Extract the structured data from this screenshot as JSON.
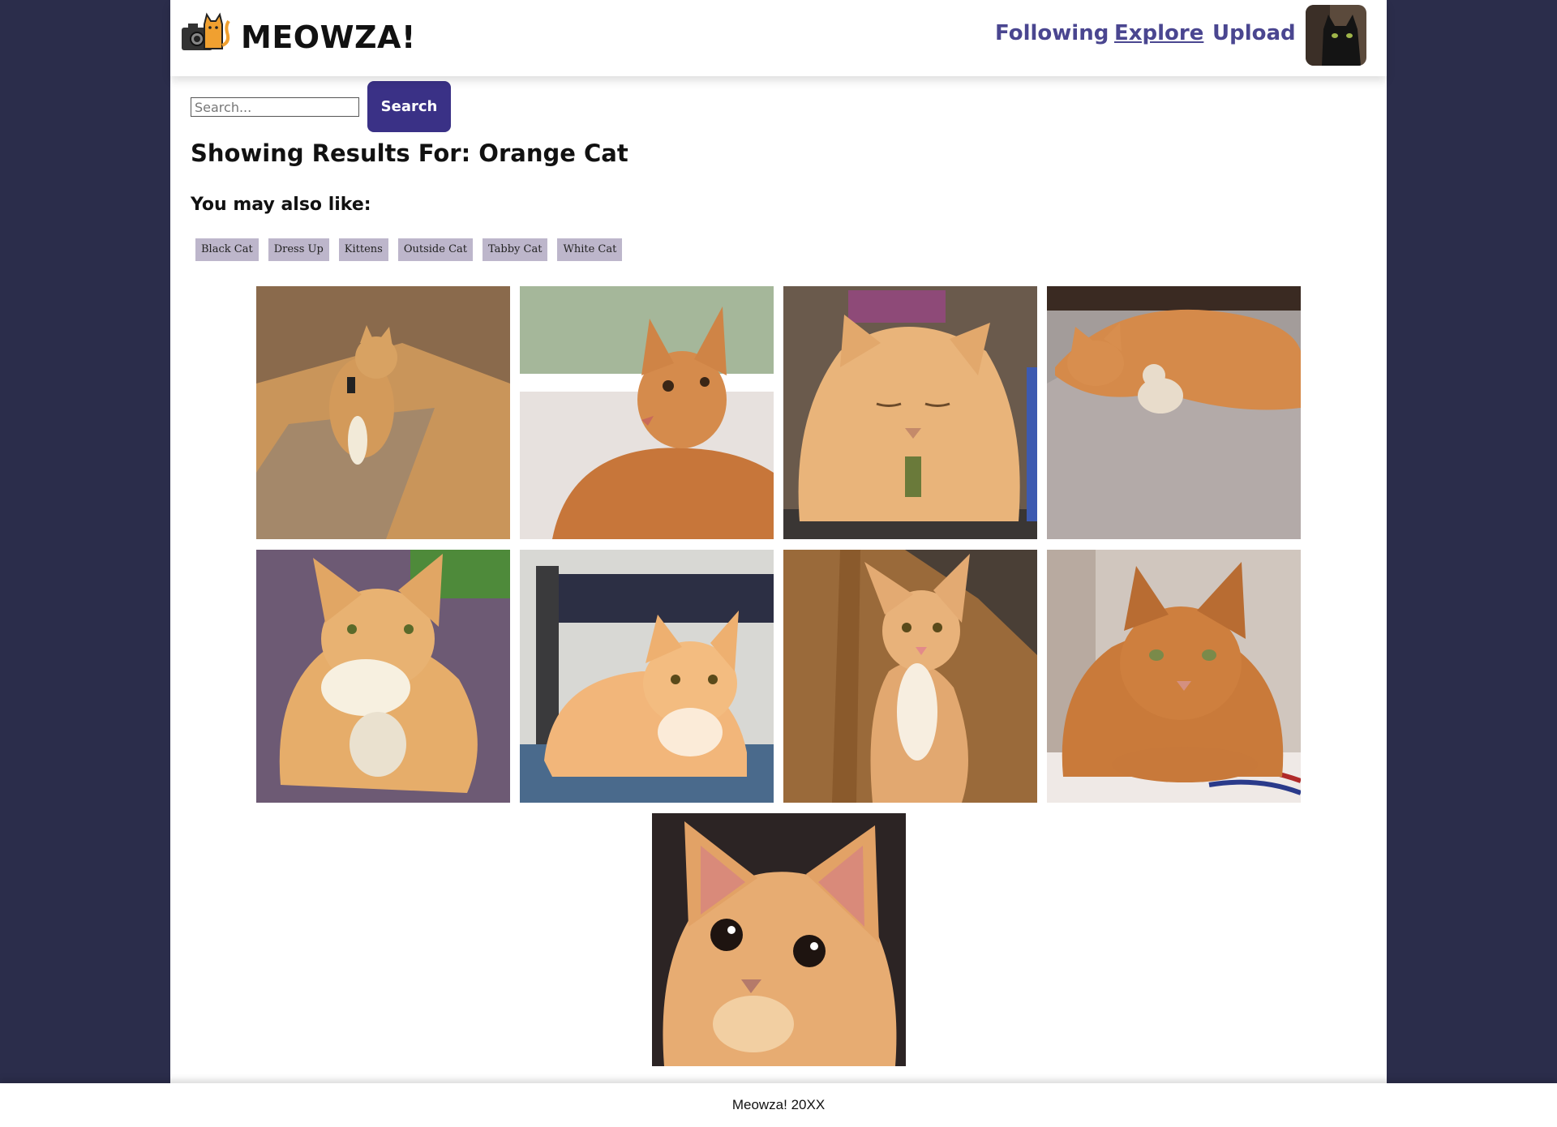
{
  "brand": {
    "name": "MEOWZA!",
    "logo_icon": "cat-camera-icon"
  },
  "nav": {
    "following": "Following",
    "explore": "Explore",
    "upload": "Upload"
  },
  "avatar_icon": "black-cat-avatar",
  "search": {
    "placeholder": "Search...",
    "value": "",
    "button_label": "Search"
  },
  "results_title": "Showing Results For: Orange Cat",
  "also_like_label": "You may also like:",
  "tags": [
    "Black Cat",
    "Dress Up",
    "Kittens",
    "Outside Cat",
    "Tabby Cat",
    "White Cat"
  ],
  "photos": [
    {
      "subject": "orange cat sitting on cardboard"
    },
    {
      "subject": "orange tabby by window"
    },
    {
      "subject": "orange cat loafing with eyes closed"
    },
    {
      "subject": "orange cat sleeping on blanket with plush toy"
    },
    {
      "subject": "orange and white cat with plush toy"
    },
    {
      "subject": "fluffy orange cat on bed"
    },
    {
      "subject": "orange tabby on wood floor"
    },
    {
      "subject": "orange cat lying on striped pillow"
    },
    {
      "subject": "orange cat close-up face"
    }
  ],
  "footer": "Meowza! 20XX",
  "colors": {
    "background": "#2b2d4b",
    "accent": "#3a3186",
    "link": "#4a4690",
    "tag": "#bdb6cb"
  }
}
